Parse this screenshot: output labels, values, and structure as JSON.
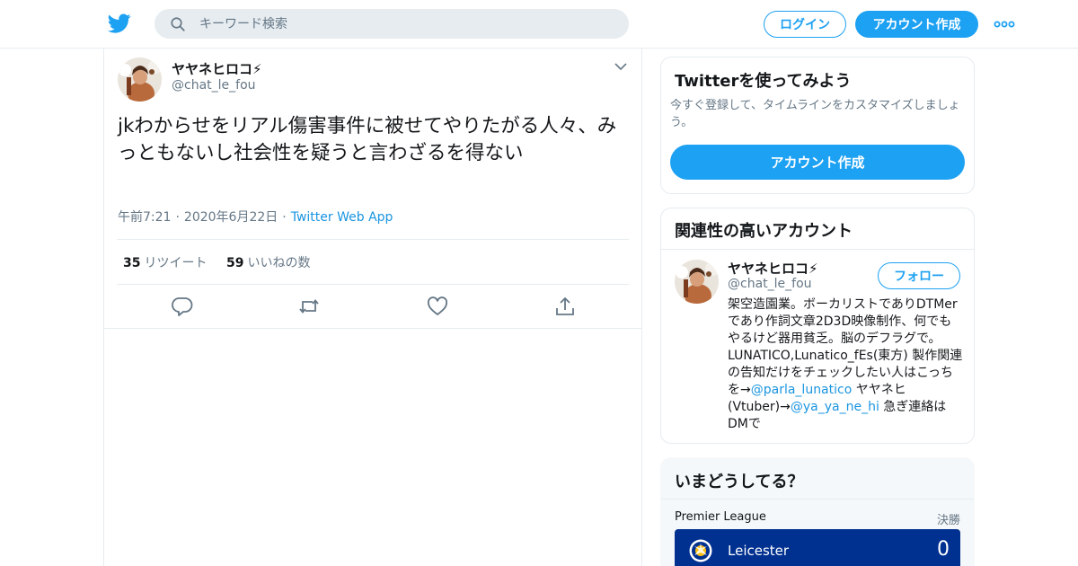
{
  "header": {
    "search_placeholder": "キーワード検索",
    "login_label": "ログイン",
    "signup_label": "アカウント作成"
  },
  "tweet": {
    "name": "ヤヤネヒロコ⚡",
    "handle": "@chat_le_fou",
    "text": "jkわからせをリアル傷害事件に被せてやりたがる人々、みっともないし社会性を疑うと言わざるを得ない",
    "time": "午前7:21",
    "date": "2020年6月22日",
    "separator": "·",
    "source": "Twitter Web App",
    "retweet_count": "35",
    "retweet_label": "リツイート",
    "like_count": "59",
    "like_label": "いいねの数"
  },
  "sidebar": {
    "try_card": {
      "title": "Twitterを使ってみよう",
      "description": "今すぐ登録して、タイムラインをカスタマイズしましょう。",
      "button_label": "アカウント作成"
    },
    "related": {
      "title": "関連性の高いアカウント",
      "account_name": "ヤヤネヒロコ⚡",
      "account_handle": "@chat_le_fou",
      "follow_label": "フォロー",
      "bio_part1": "架空造園業。ボーカリストでありDTMerであり作詞文章2D3D映像制作、何でもやるけど器用貧乏。脳のデフラグで。LUNATICO,Lunatico_fEs(東方) 製作関連の告知だけをチェックしたい人はこっちを→",
      "bio_link1": "@parla_lunatico",
      "bio_part2": " ヤヤネヒ(Vtuber)→",
      "bio_link2": "@ya_ya_ne_hi",
      "bio_part3": " 急ぎ連絡はDMで"
    },
    "trends": {
      "title": "いまどうしてる？",
      "league": "Premier League",
      "status": "決勝",
      "team_name": "Leicester",
      "team_score": "0"
    }
  },
  "colors": {
    "accent": "#1da1f2",
    "link": "#1b95e0",
    "secondary_text": "#657786",
    "border": "#e6ecf0",
    "leicester_blue": "#003090"
  },
  "icons": [
    "twitter-bird-icon",
    "search-icon",
    "more-icon",
    "chevron-down-icon",
    "reply-icon",
    "retweet-icon",
    "like-icon",
    "share-icon",
    "leicester-crest-icon"
  ]
}
